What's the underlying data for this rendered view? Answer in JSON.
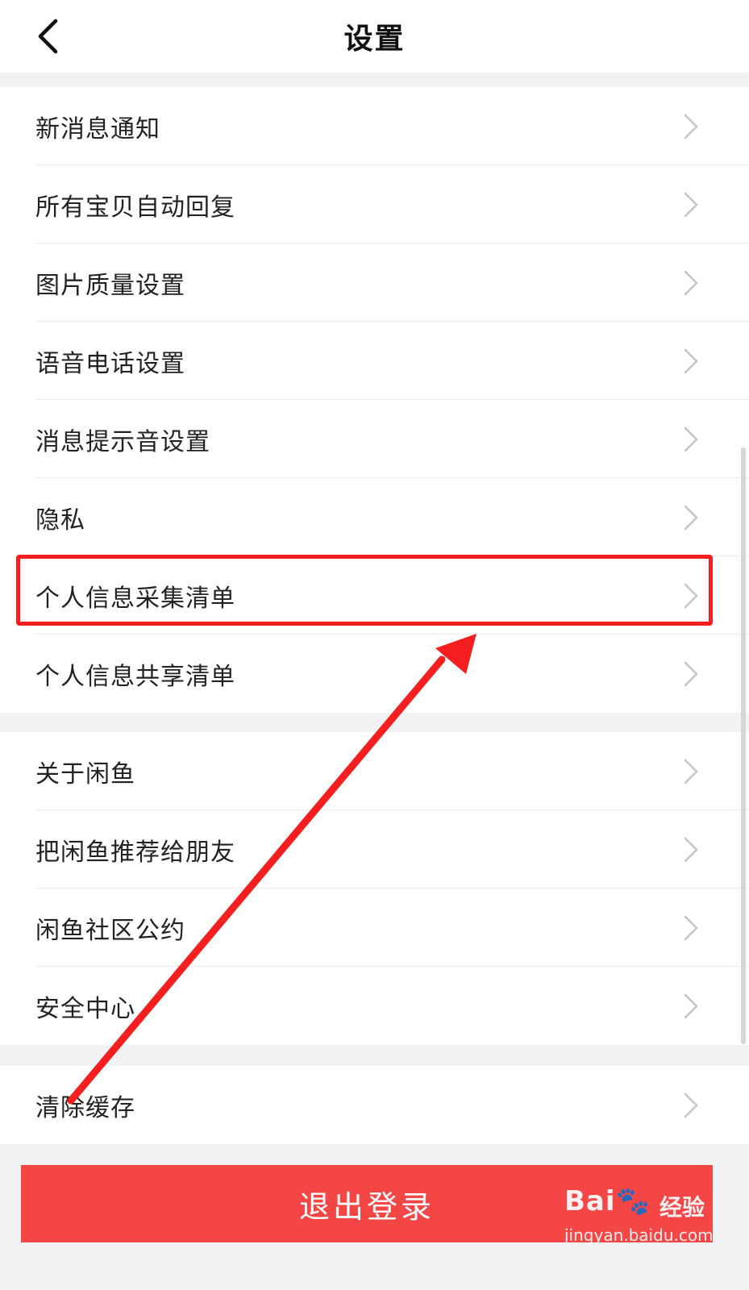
{
  "header": {
    "title": "设置"
  },
  "groups": [
    {
      "items": [
        "新消息通知",
        "所有宝贝自动回复",
        "图片质量设置",
        "语音电话设置",
        "消息提示音设置",
        "隐私",
        "个人信息采集清单",
        "个人信息共享清单"
      ]
    },
    {
      "items": [
        "关于闲鱼",
        "把闲鱼推荐给朋友",
        "闲鱼社区公约",
        "安全中心"
      ]
    },
    {
      "items": [
        "清除缓存"
      ]
    }
  ],
  "logout": {
    "label": "退出登录"
  },
  "watermark": {
    "brand": "Bai🐾",
    "suffix": "经验",
    "url": "jingyan.baidu.com"
  },
  "colors": {
    "accent": "#f54646",
    "annotation": "#f51f1f",
    "background": "#f2f2f5"
  },
  "icons": {
    "back": "chevron-left-icon",
    "row": "chevron-right-icon"
  }
}
